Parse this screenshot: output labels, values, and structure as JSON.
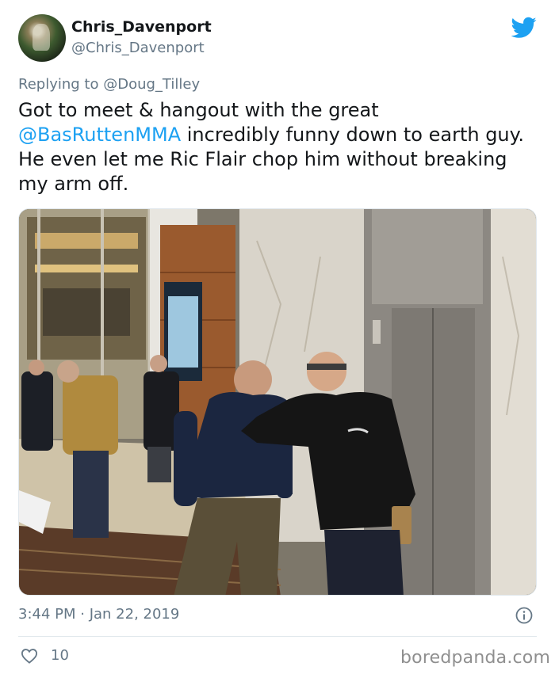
{
  "tweet": {
    "display_name": "Chris_Davenport",
    "handle": "@Chris_Davenport",
    "reply_prefix": "Replying to",
    "reply_to": "@Doug_Tilley",
    "text_mention": "@BasRuttenMMA",
    "text_part1": "Got to meet & hangout with the great",
    "text_part2": "incredibly funny down to earth guy. He even let me Ric Flair chop him without breaking my arm off.",
    "timestamp": "3:44 PM · Jan 22, 2019",
    "like_count": "10"
  },
  "icons": {
    "brand": "twitter-bird-icon",
    "info": "info-icon",
    "like": "heart-icon"
  },
  "colors": {
    "accent": "#1da1f2",
    "secondary_text": "#657786",
    "text": "#14171a"
  },
  "watermark": "boredpanda.com"
}
